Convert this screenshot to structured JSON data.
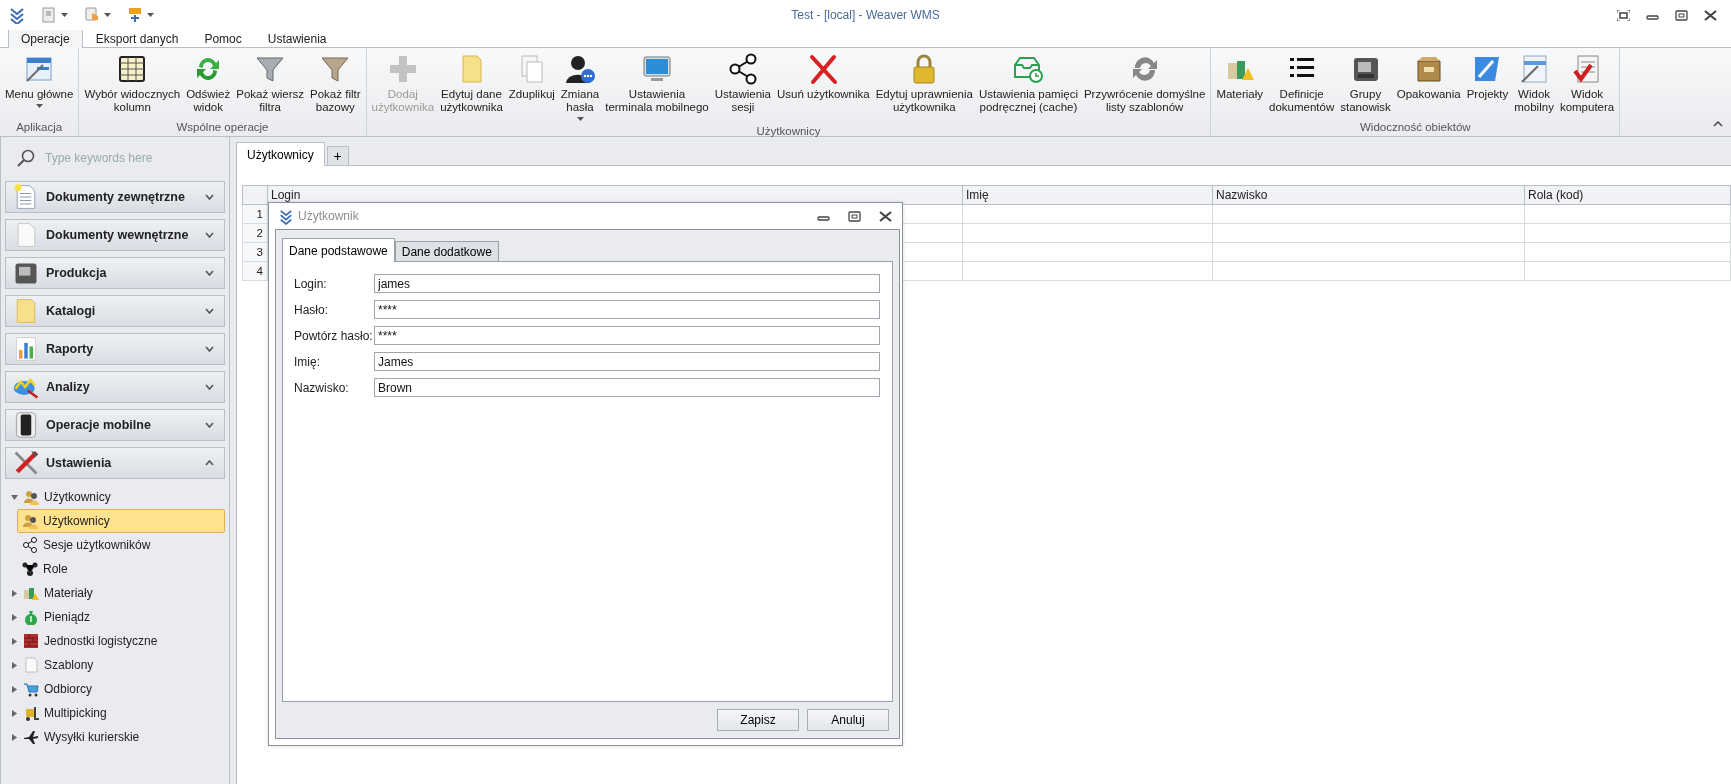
{
  "window": {
    "title": "Test - [local] - Weaver WMS"
  },
  "quick_access": [
    {
      "dropdown": false
    },
    {
      "dropdown": true
    },
    {
      "dropdown": true
    },
    {
      "dropdown": true
    }
  ],
  "ribbon_tabs": [
    {
      "label": "Operacje",
      "selected": true
    },
    {
      "label": "Eksport danych",
      "selected": false
    },
    {
      "label": "Pomoc",
      "selected": false
    },
    {
      "label": "Ustawienia",
      "selected": false
    }
  ],
  "ribbon_groups": [
    {
      "label": "Aplikacja",
      "buttons": [
        {
          "label": "Menu główne",
          "disabled": false,
          "dropdown": true
        }
      ]
    },
    {
      "label": "Wspólne operacje",
      "buttons": [
        {
          "label": "Wybór widocznych\nkolumn",
          "disabled": false,
          "dropdown": false
        },
        {
          "label": "Odśwież\nwidok",
          "disabled": false,
          "dropdown": false
        },
        {
          "label": "Pokaż wiersz\nfiltra",
          "disabled": false,
          "dropdown": false
        },
        {
          "label": "Pokaż filtr\nbazowy",
          "disabled": false,
          "dropdown": false
        }
      ]
    },
    {
      "label": "Użytkownicy",
      "buttons": [
        {
          "label": "Dodaj\nużytkownika",
          "disabled": true,
          "dropdown": false
        },
        {
          "label": "Edytuj dane\nużytkownika",
          "disabled": false,
          "dropdown": false
        },
        {
          "label": "Zduplikuj",
          "disabled": false,
          "dropdown": false
        },
        {
          "label": "Zmiana\nhasła",
          "disabled": false,
          "dropdown": true
        },
        {
          "label": "Ustawienia\nterminala mobilnego",
          "disabled": false,
          "dropdown": false
        },
        {
          "label": "Ustawienia\nsesji",
          "disabled": false,
          "dropdown": false
        },
        {
          "label": "Usuń użytkownika",
          "disabled": false,
          "dropdown": false
        },
        {
          "label": "Edytuj uprawnienia\nużytkownika",
          "disabled": false,
          "dropdown": false
        },
        {
          "label": "Ustawienia pamięci\npodręcznej (cache)",
          "disabled": false,
          "dropdown": false
        },
        {
          "label": "Przywrócenie domyślne\nlisty szablonów",
          "disabled": false,
          "dropdown": false
        }
      ]
    },
    {
      "label": "Widoczność obiektów",
      "buttons": [
        {
          "label": "Materiały",
          "disabled": false,
          "dropdown": false
        },
        {
          "label": "Definicje\ndokumentów",
          "disabled": false,
          "dropdown": false
        },
        {
          "label": "Grupy\nstanowisk",
          "disabled": false,
          "dropdown": false
        },
        {
          "label": "Opakowania",
          "disabled": false,
          "dropdown": false
        },
        {
          "label": "Projekty",
          "disabled": false,
          "dropdown": false
        },
        {
          "label": "Widok\nmobilny",
          "disabled": false,
          "dropdown": false
        },
        {
          "label": "Widok\nkomputera",
          "disabled": false,
          "dropdown": false
        }
      ]
    }
  ],
  "sidebar": {
    "search": {
      "placeholder": "Type keywords here"
    },
    "groups": [
      {
        "label": "Dokumenty zewnętrzne",
        "expanded": false
      },
      {
        "label": "Dokumenty wewnętrzne",
        "expanded": false
      },
      {
        "label": "Produkcja",
        "expanded": false
      },
      {
        "label": "Katalogi",
        "expanded": false
      },
      {
        "label": "Raporty",
        "expanded": false
      },
      {
        "label": "Analizy",
        "expanded": false
      },
      {
        "label": "Operacje mobilne",
        "expanded": false
      },
      {
        "label": "Ustawienia",
        "expanded": true
      }
    ],
    "tree": [
      {
        "label": "Użytkownicy",
        "expanded": true,
        "selected": false,
        "children": [
          {
            "label": "Użytkownicy",
            "selected": true
          },
          {
            "label": "Sesje użytkowników",
            "selected": false
          },
          {
            "label": "Role",
            "selected": false
          }
        ]
      },
      {
        "label": "Materiały",
        "expanded": false,
        "selected": false
      },
      {
        "label": "Pieniądz",
        "expanded": false,
        "selected": false
      },
      {
        "label": "Jednostki logistyczne",
        "expanded": false,
        "selected": false
      },
      {
        "label": "Szablony",
        "expanded": false,
        "selected": false
      },
      {
        "label": "Odbiorcy",
        "expanded": false,
        "selected": false
      },
      {
        "label": "Multipicking",
        "expanded": false,
        "selected": false
      },
      {
        "label": "Wysyłki kurierskie",
        "expanded": false,
        "selected": false
      }
    ]
  },
  "document_tabs": [
    {
      "label": "Użytkownicy",
      "selected": true
    }
  ],
  "new_tab_button": "+",
  "table": {
    "columns": [
      "Login",
      "Imię",
      "Nazwisko",
      "Rola (kod)"
    ],
    "rows": [
      {
        "number": "1"
      },
      {
        "number": "2"
      },
      {
        "number": "3"
      },
      {
        "number": "4"
      }
    ]
  },
  "dialog": {
    "title": "Użytkownik",
    "tabs": [
      {
        "label": "Dane podstawowe",
        "selected": true
      },
      {
        "label": "Dane dodatkowe",
        "selected": false
      }
    ],
    "fields": [
      {
        "label": "Login:",
        "value": "james"
      },
      {
        "label": "Hasło:",
        "value": "****"
      },
      {
        "label": "Powtórz hasło:",
        "value": "****"
      },
      {
        "label": "Imię:",
        "value": "James"
      },
      {
        "label": "Nazwisko:",
        "value": "Brown"
      }
    ],
    "buttons": [
      "Zapisz",
      "Anuluj"
    ]
  }
}
